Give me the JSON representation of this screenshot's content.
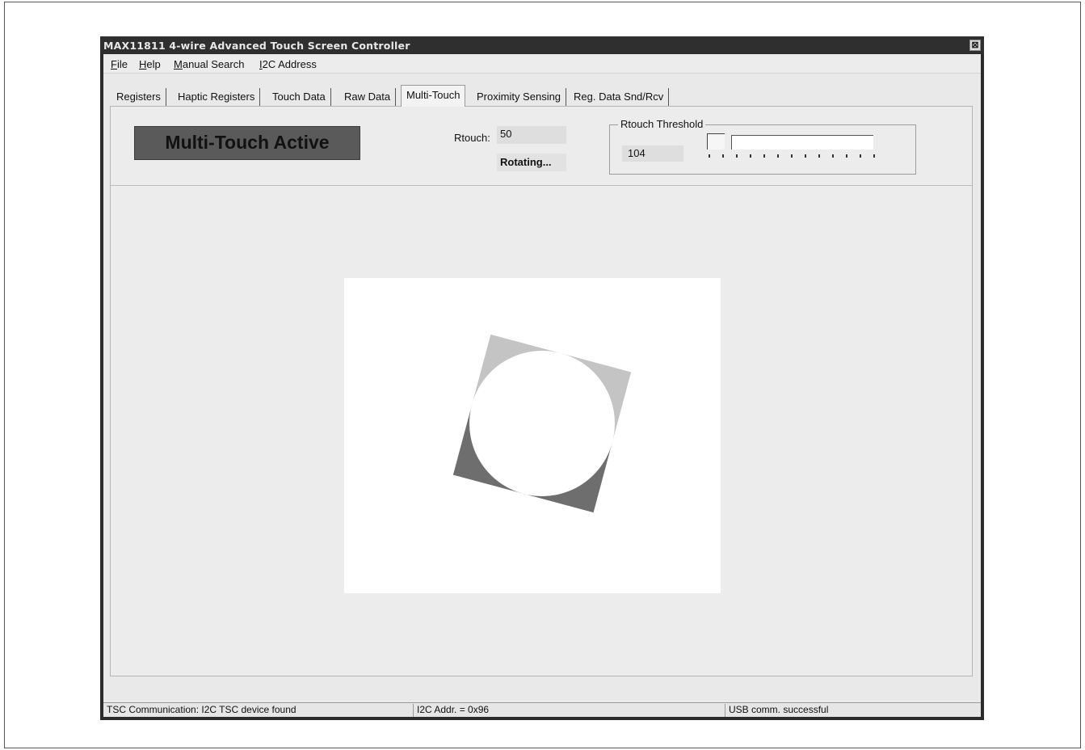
{
  "window": {
    "title": "MAX11811 4-wire Advanced Touch Screen Controller",
    "close_symbol": "⊠"
  },
  "menu": [
    {
      "first": "F",
      "rest": "ile"
    },
    {
      "first": "H",
      "rest": "elp"
    },
    {
      "first": "M",
      "rest": "anual Search"
    },
    {
      "first": "I",
      "rest": "2C Address"
    }
  ],
  "tabs": [
    {
      "label": "Registers",
      "active": false
    },
    {
      "label": "Haptic Registers",
      "active": false
    },
    {
      "label": "Touch Data",
      "active": false
    },
    {
      "label": "Raw Data",
      "active": false
    },
    {
      "label": "Multi-Touch",
      "active": true
    },
    {
      "label": "Proximity Sensing",
      "active": false
    },
    {
      "label": "Reg. Data Snd/Rcv",
      "active": false
    }
  ],
  "multitouch": {
    "banner": "Multi-Touch Active",
    "rtouch_label": "Rtouch:",
    "rtouch_value": "50",
    "status": "Rotating...",
    "threshold_label": "Rtouch Threshold",
    "threshold_value": "104",
    "threshold_level_fraction": 0.0,
    "square_rotation_deg": 15
  },
  "statusbar": {
    "tsc": "TSC Communication: I2C TSC device found",
    "i2c": "I2C Addr. = 0x96",
    "usb": "USB comm. successful"
  },
  "colors": {
    "banner_bg": "#5a5a5a",
    "square_light": "#c4c4c4",
    "square_dark": "#6e6e6e",
    "circle": "#ffffff"
  }
}
